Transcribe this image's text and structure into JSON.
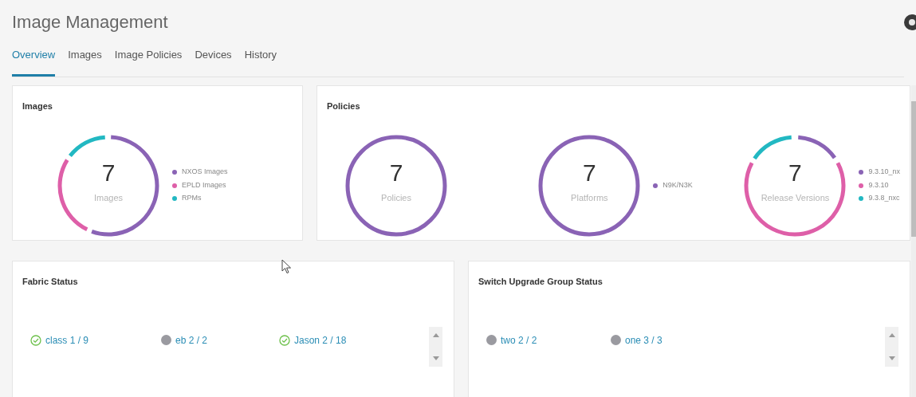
{
  "header": {
    "title": "Image Management"
  },
  "tabs": [
    {
      "label": "Overview",
      "selected": true
    },
    {
      "label": "Images",
      "selected": false
    },
    {
      "label": "Image Policies",
      "selected": false
    },
    {
      "label": "Devices",
      "selected": false
    },
    {
      "label": "History",
      "selected": false
    }
  ],
  "images_card": {
    "title": "Images",
    "total": "7",
    "caption": "Images",
    "legend": [
      {
        "label": "NXOS Images",
        "color": "#8a63b5"
      },
      {
        "label": "EPLD Images",
        "color": "#de5fa8"
      },
      {
        "label": "RPMs",
        "color": "#22b8c2"
      }
    ]
  },
  "policies_card": {
    "title": "Policies",
    "charts": [
      {
        "total": "7",
        "caption": "Policies"
      },
      {
        "total": "7",
        "caption": "Platforms",
        "legend": [
          {
            "label": "N9K/N3K",
            "color": "#8a63b5"
          }
        ]
      },
      {
        "total": "7",
        "caption": "Release Versions",
        "legend": [
          {
            "label": "9.3.10_nx",
            "color": "#8a63b5"
          },
          {
            "label": "9.3.10",
            "color": "#de5fa8"
          },
          {
            "label": "9.3.8_nxc",
            "color": "#22b8c2"
          }
        ]
      }
    ]
  },
  "status_cards": [
    {
      "title": "Fabric Status",
      "items": [
        {
          "label": "class 1 / 9",
          "kind": "ok"
        },
        {
          "label": "eb 2 / 2",
          "kind": "idle"
        },
        {
          "label": "Jason 2 / 18",
          "kind": "ok"
        }
      ]
    },
    {
      "title": "Switch Upgrade Group Status",
      "items": [
        {
          "label": "two 2 / 2",
          "kind": "idle"
        },
        {
          "label": "one 3 / 3",
          "kind": "idle"
        }
      ]
    }
  ]
}
